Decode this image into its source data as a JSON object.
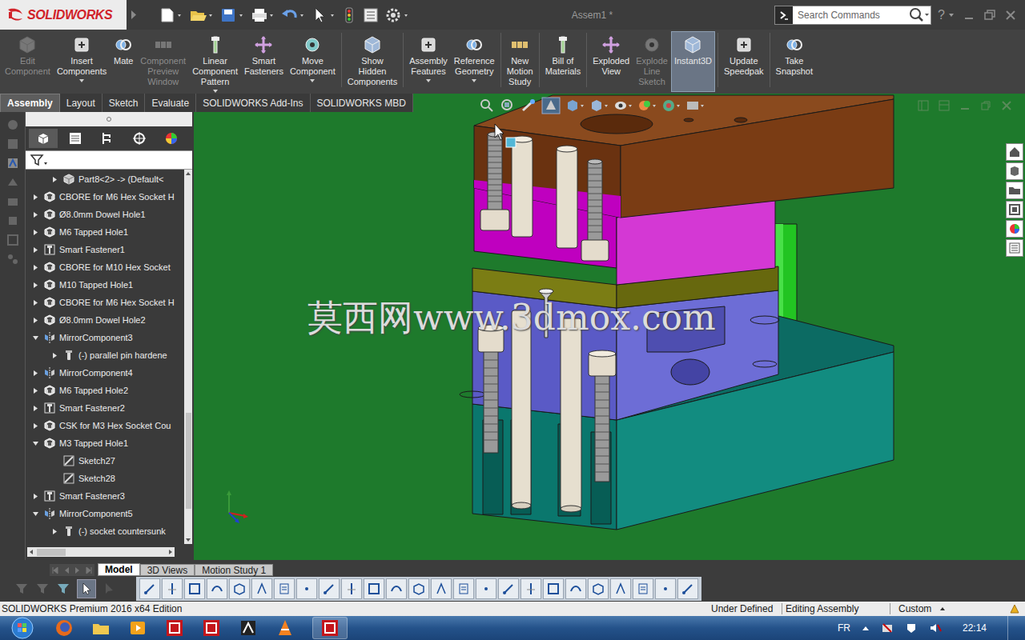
{
  "app": {
    "logo": "SOLIDWORKS"
  },
  "window": {
    "title": "Assem1 *"
  },
  "search": {
    "placeholder": "Search Commands"
  },
  "help": "?",
  "ribbon": {
    "groups": [
      [
        {
          "lines": [
            "Edit",
            "Component"
          ],
          "disabled": true,
          "selected": false,
          "dropdown": false
        },
        {
          "lines": [
            "Insert",
            "Components"
          ],
          "disabled": false,
          "selected": false,
          "dropdown": true
        },
        {
          "lines": [
            "Mate"
          ],
          "disabled": false,
          "selected": false,
          "dropdown": false
        },
        {
          "lines": [
            "Component",
            "Preview",
            "Window"
          ],
          "disabled": true,
          "selected": false,
          "dropdown": false
        },
        {
          "lines": [
            "Linear",
            "Component",
            "Pattern"
          ],
          "disabled": false,
          "selected": false,
          "dropdown": true
        },
        {
          "lines": [
            "Smart",
            "Fasteners"
          ],
          "disabled": false,
          "selected": false,
          "dropdown": false
        },
        {
          "lines": [
            "Move",
            "Component"
          ],
          "disabled": false,
          "selected": false,
          "dropdown": true
        }
      ],
      [
        {
          "lines": [
            "Show",
            "Hidden",
            "Components"
          ],
          "disabled": false,
          "selected": false,
          "dropdown": false
        }
      ],
      [
        {
          "lines": [
            "Assembly",
            "Features"
          ],
          "disabled": false,
          "selected": false,
          "dropdown": true
        },
        {
          "lines": [
            "Reference",
            "Geometry"
          ],
          "disabled": false,
          "selected": false,
          "dropdown": true
        }
      ],
      [
        {
          "lines": [
            "New",
            "Motion",
            "Study"
          ],
          "disabled": false,
          "selected": false,
          "dropdown": false
        }
      ],
      [
        {
          "lines": [
            "Bill of",
            "Materials"
          ],
          "disabled": false,
          "selected": false,
          "dropdown": false
        }
      ],
      [
        {
          "lines": [
            "Exploded",
            "View"
          ],
          "disabled": false,
          "selected": false,
          "dropdown": false
        },
        {
          "lines": [
            "Explode",
            "Line",
            "Sketch"
          ],
          "disabled": true,
          "selected": false,
          "dropdown": false
        },
        {
          "lines": [
            "Instant3D"
          ],
          "disabled": false,
          "selected": true,
          "dropdown": false
        }
      ],
      [
        {
          "lines": [
            "Update",
            "Speedpak"
          ],
          "disabled": false,
          "selected": false,
          "dropdown": false
        }
      ],
      [
        {
          "lines": [
            "Take",
            "Snapshot"
          ],
          "disabled": false,
          "selected": false,
          "dropdown": false
        }
      ]
    ]
  },
  "tabs": [
    {
      "label": "Assembly",
      "selected": true
    },
    {
      "label": "Layout",
      "selected": false
    },
    {
      "label": "Sketch",
      "selected": false
    },
    {
      "label": "Evaluate",
      "selected": false
    },
    {
      "label": "SOLIDWORKS Add-Ins",
      "selected": false
    },
    {
      "label": "SOLIDWORKS MBD",
      "selected": false
    }
  ],
  "tree": {
    "items": [
      {
        "text": "Part8<2> -> (Default<",
        "depth": 1,
        "expandable": true,
        "expanded": false,
        "kind": "part"
      },
      {
        "text": "CBORE for M6 Hex Socket H",
        "depth": 0,
        "expandable": true,
        "expanded": false,
        "kind": "hole"
      },
      {
        "text": "Ø8.0mm Dowel Hole1",
        "depth": 0,
        "expandable": true,
        "expanded": false,
        "kind": "hole"
      },
      {
        "text": "M6 Tapped Hole1",
        "depth": 0,
        "expandable": true,
        "expanded": false,
        "kind": "hole"
      },
      {
        "text": "Smart Fastener1",
        "depth": 0,
        "expandable": true,
        "expanded": false,
        "kind": "fastener"
      },
      {
        "text": "CBORE for M10 Hex Socket",
        "depth": 0,
        "expandable": true,
        "expanded": false,
        "kind": "hole"
      },
      {
        "text": "M10 Tapped Hole1",
        "depth": 0,
        "expandable": true,
        "expanded": false,
        "kind": "hole"
      },
      {
        "text": "CBORE for M6 Hex Socket H",
        "depth": 0,
        "expandable": true,
        "expanded": false,
        "kind": "hole"
      },
      {
        "text": "Ø8.0mm Dowel Hole2",
        "depth": 0,
        "expandable": true,
        "expanded": false,
        "kind": "hole"
      },
      {
        "text": "MirrorComponent3",
        "depth": 0,
        "expandable": true,
        "expanded": true,
        "kind": "mirror"
      },
      {
        "text": "(-) parallel pin hardene",
        "depth": 1,
        "expandable": true,
        "expanded": false,
        "kind": "pin"
      },
      {
        "text": "MirrorComponent4",
        "depth": 0,
        "expandable": true,
        "expanded": false,
        "kind": "mirror"
      },
      {
        "text": "M6 Tapped Hole2",
        "depth": 0,
        "expandable": true,
        "expanded": false,
        "kind": "hole"
      },
      {
        "text": "Smart Fastener2",
        "depth": 0,
        "expandable": true,
        "expanded": false,
        "kind": "fastener"
      },
      {
        "text": "CSK for M3 Hex Socket Cou",
        "depth": 0,
        "expandable": true,
        "expanded": false,
        "kind": "hole"
      },
      {
        "text": "M3 Tapped Hole1",
        "depth": 0,
        "expandable": true,
        "expanded": true,
        "kind": "hole"
      },
      {
        "text": "Sketch27",
        "depth": 1,
        "expandable": false,
        "expanded": false,
        "kind": "sketch"
      },
      {
        "text": "Sketch28",
        "depth": 1,
        "expandable": false,
        "expanded": false,
        "kind": "sketch"
      },
      {
        "text": "Smart Fastener3",
        "depth": 0,
        "expandable": true,
        "expanded": false,
        "kind": "fastener"
      },
      {
        "text": "MirrorComponent5",
        "depth": 0,
        "expandable": true,
        "expanded": true,
        "kind": "mirror"
      },
      {
        "text": "(-) socket countersunk",
        "depth": 1,
        "expandable": true,
        "expanded": false,
        "kind": "pin"
      }
    ]
  },
  "watermark": "莫西网www.3dmox.com",
  "bottom_tabs": [
    {
      "label": "Model",
      "selected": true
    },
    {
      "label": "3D Views",
      "selected": false
    },
    {
      "label": "Motion Study 1",
      "selected": false
    }
  ],
  "status_bar": {
    "edition": "SOLIDWORKS Premium 2016 x64 Edition",
    "state": "Under Defined",
    "mode": "Editing Assembly",
    "units": "Custom"
  },
  "taskbar": {
    "language": "FR",
    "time": "22:14"
  }
}
